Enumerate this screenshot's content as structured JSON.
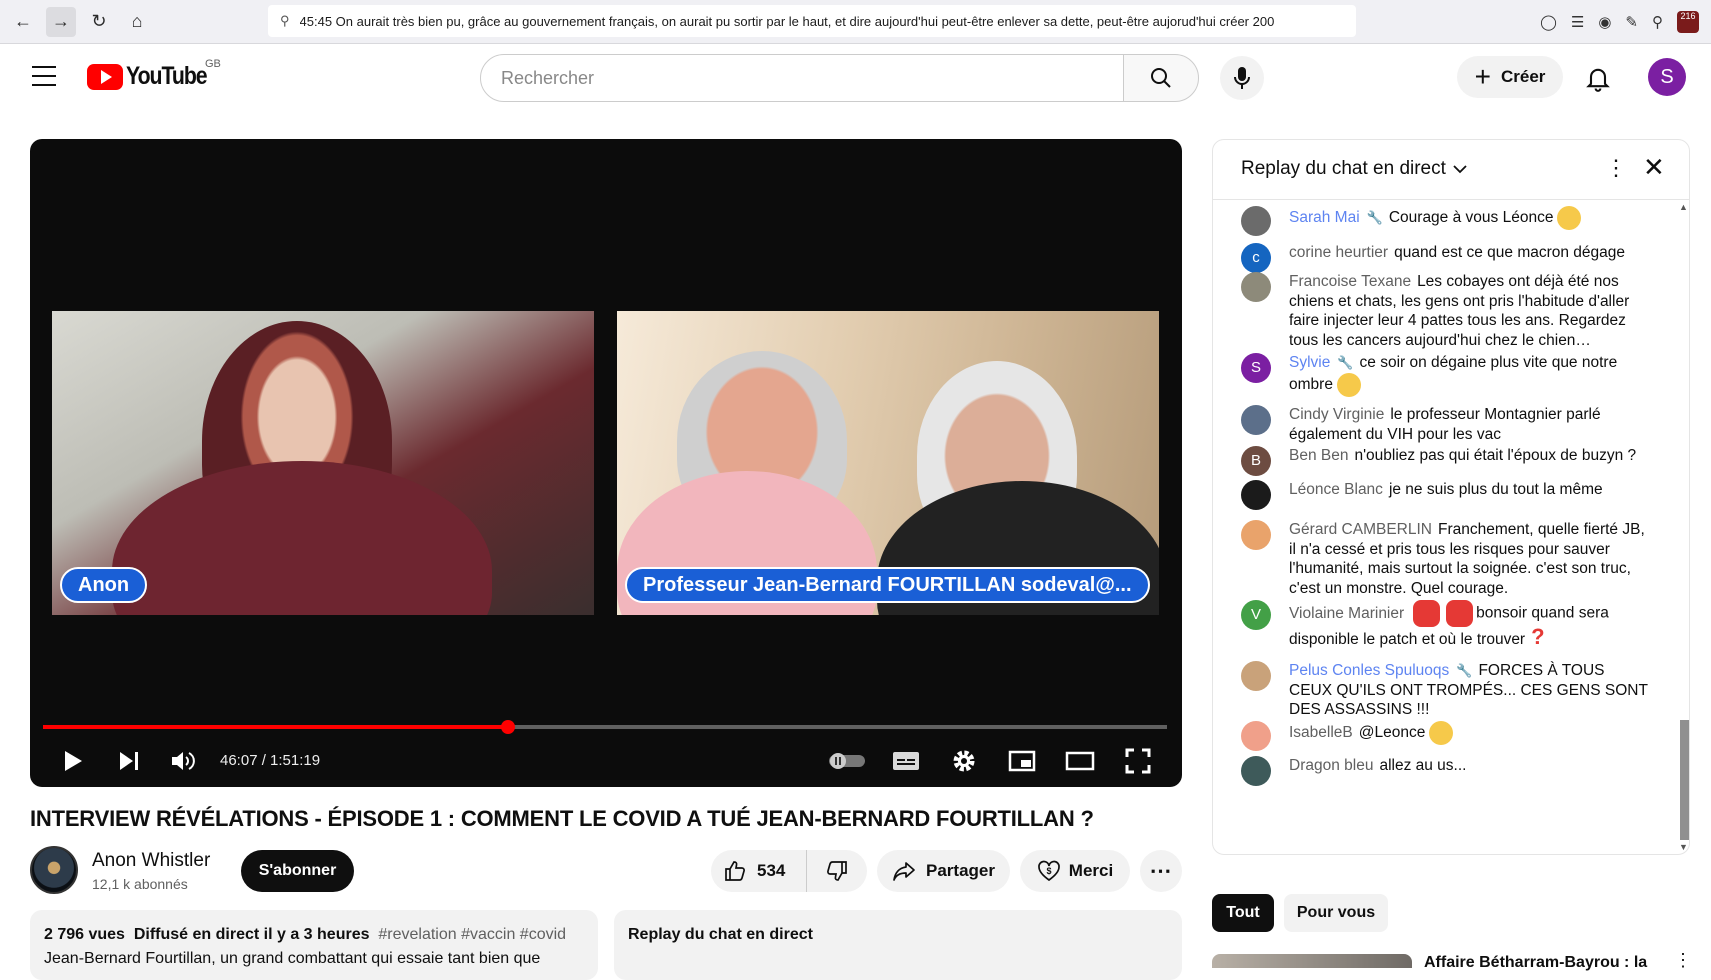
{
  "browser": {
    "url_text": "45:45 On aurait très bien pu, grâce au gouvernement français, on aurait pu sortir par le haut, et dire aujourd'hui peut-être enlever sa dette, peut-être aujorud'hui créer 200",
    "extension_badge": "216"
  },
  "header": {
    "logo_text": "YouTube",
    "region": "GB",
    "search_placeholder": "Rechercher",
    "create_label": "Créer",
    "avatar_letter": "S"
  },
  "player": {
    "left_label": "Anon",
    "right_label": "Professeur Jean-Bernard FOURTILLAN sodeval@...",
    "time": "46:07 / 1:51:19",
    "progress": 0.414
  },
  "video": {
    "title": "INTERVIEW RÉVÉLATIONS - ÉPISODE 1 : COMMENT LE COVID A TUÉ JEAN-BERNARD FOURTILLAN ?",
    "channel_name": "Anon Whistler",
    "subscribers": "12,1 k abonnés",
    "subscribe_label": "S'abonner",
    "likes": "534",
    "share_label": "Partager",
    "thanks_label": "Merci"
  },
  "description": {
    "views": "2 796 vues",
    "broadcast": "Diffusé en direct il y a 3 heures",
    "tags": "#revelation #vaccin #covid",
    "line2": "Jean-Bernard Fourtillan, un grand combattant qui essaie tant bien que"
  },
  "chat_replay_box": {
    "label": "Replay du chat en direct"
  },
  "chat": {
    "title": "Replay du chat en direct",
    "messages": [
      {
        "author": "Sarah Mai",
        "text": "Courage à vous Léonce",
        "mod": true,
        "avatar_letter": "",
        "avatar_color": "#6b6b6b"
      },
      {
        "author": "corine heurtier",
        "text": "quand est ce que macron dégage",
        "mod": false,
        "avatar_letter": "c",
        "avatar_color": "#1565c0"
      },
      {
        "author": "Francoise Texane",
        "text": "Les cobayes ont déjà été nos chiens et chats, les gens ont pris l'habitude d'aller faire injecter leur 4 pattes tous les ans. Regardez tous les cancers aujourd'hui chez le chien…",
        "mod": false,
        "avatar_letter": "",
        "avatar_color": "#8d8a7a"
      },
      {
        "author": "Sylvie",
        "text": "ce soir on dégaine plus vite que notre ombre",
        "mod": true,
        "avatar_letter": "S",
        "avatar_color": "#7b1fa2"
      },
      {
        "author": "Cindy Virginie",
        "text": "le professeur Montagnier parlé également du VIH pour les vac",
        "mod": false,
        "avatar_letter": "",
        "avatar_color": "#5c6f8a"
      },
      {
        "author": "Ben Ben",
        "text": "n'oubliez pas qui était l'époux de buzyn ?",
        "mod": false,
        "avatar_letter": "B",
        "avatar_color": "#6d4c41"
      },
      {
        "author": "Léonce Blanc",
        "text": "je ne suis plus du tout la même",
        "mod": false,
        "avatar_letter": "",
        "avatar_color": "#1b1b1b"
      },
      {
        "author": "Gérard CAMBERLIN",
        "text": "Franchement, quelle fierté JB, il n'a cessé et pris tous les risques pour sauver l'humanité, mais surtout la soignée. c'est son truc, c'est un monstre. Quel courage.",
        "mod": false,
        "avatar_letter": "",
        "avatar_color": "#e9a36b"
      },
      {
        "author": "Violaine Marinier",
        "text_before": "",
        "text": "bonsoir quand sera disponible le patch et où le trouver",
        "mod": false,
        "avatar_letter": "V",
        "avatar_color": "#43a047"
      },
      {
        "author": "Pelus Conles Spuluoqs",
        "text": "FORCES À TOUS CEUX QU'ILS ONT TROMPÉS... CES GENS SONT DES ASSASSINS !!!",
        "mod": true,
        "avatar_letter": "",
        "avatar_color": "#c9a27a"
      },
      {
        "author": "IsabelleB",
        "text": "@Leonce",
        "mod": false,
        "avatar_letter": "",
        "avatar_color": "#f0a08a"
      },
      {
        "author": "Dragon bleu",
        "text": "allez au us...",
        "mod": false,
        "avatar_letter": "",
        "avatar_color": "#3e5a5a"
      }
    ]
  },
  "filters": {
    "all": "Tout",
    "for_you": "Pour vous"
  },
  "suggestion": {
    "title": "Affaire Bétharram-Bayrou : la"
  },
  "colors": {
    "accent": "#ff0000",
    "mod_author": "#5e84f1",
    "label_blue": "#1a5fd6"
  }
}
